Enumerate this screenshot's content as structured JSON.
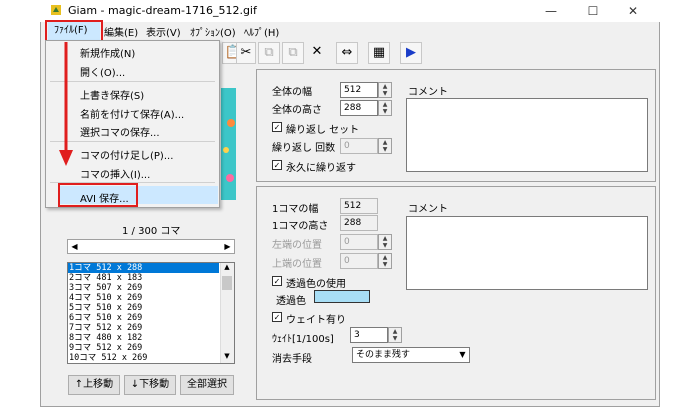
{
  "window": {
    "title": "Giam - magic-dream-1716_512.gif",
    "minimize": "—",
    "maximize": "☐",
    "close": "✕"
  },
  "menubar": {
    "file": "ﾌｧｲﾙ(F)",
    "edit": "編集(E)",
    "view": "表示(V)",
    "options": "ｵﾌﾟｼｮﾝ(O)",
    "help": "ﾍﾙﾌﾟ(H)"
  },
  "file_menu": {
    "items": [
      "新規作成(N)",
      "開く(O)...",
      "上書き保存(S)",
      "名前を付けて保存(A)...",
      "選択コマの保存...",
      "コマの付け足し(P)...",
      "コマの挿入(I)...",
      "AVI 保存..."
    ]
  },
  "global": {
    "width_label": "全体の幅",
    "width_value": "512",
    "height_label": "全体の高さ",
    "height_value": "288",
    "loop_label": "繰り返し セット",
    "loop_count_label": "繰り返し 回数",
    "loop_count_value": "0",
    "forever_label": "永久に繰り返す",
    "comment_label": "コメント"
  },
  "frame": {
    "width_label": "1コマの幅",
    "width_value": "512",
    "height_label": "1コマの高さ",
    "height_value": "288",
    "left_label": "左端の位置",
    "left_value": "0",
    "top_label": "上端の位置",
    "top_value": "0",
    "transparent_label": "透過色の使用",
    "transparent_color_label": "透過色",
    "wait_label": "ウェイト有り",
    "wait_time_label": "ｳｪｲﾄ[1/100s]",
    "wait_time_value": "3",
    "dispose_label": "消去手段",
    "dispose_value": "そのまま残す",
    "comment_label": "コメント",
    "transparent_color": "#a8def5"
  },
  "frame_counter": "1 / 300 コマ",
  "frame_list": [
    "1コマ 512 x 288",
    "2コマ 481 x 183",
    "3コマ 507 x 269",
    "4コマ 510 x 269",
    "5コマ 510 x 269",
    "6コマ 510 x 269",
    "7コマ 512 x 269",
    "8コマ 480 x 182",
    "9コマ 512 x 269",
    "10コマ 512 x 269"
  ],
  "buttons": {
    "move_up": "↑上移動",
    "move_down": "↓下移動",
    "select_all": "全部選択"
  },
  "colors": {
    "selection": "#0078d7",
    "annotation": "#e01e1e",
    "hover": "#cce8ff"
  }
}
